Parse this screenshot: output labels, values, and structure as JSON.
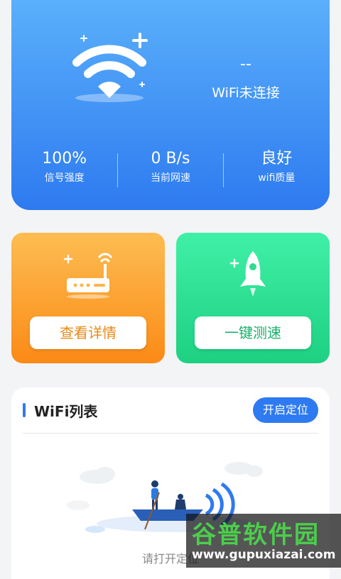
{
  "hero": {
    "ssid_placeholder": "--",
    "status_text": "WiFi未连接",
    "stats": [
      {
        "value": "100%",
        "label": "信号强度"
      },
      {
        "value": "0 B/s",
        "label": "当前网速"
      },
      {
        "value": "良好",
        "label": "wifi质量"
      }
    ]
  },
  "cards": {
    "details_button": "查看详情",
    "speedtest_button": "一键测速"
  },
  "wifi_list": {
    "title": "WiFi列表",
    "enable_location_button": "开启定位",
    "empty_hint": "请打开定位"
  },
  "watermark": {
    "brand": "谷普软件园",
    "url": "www.gupuxiazai.com"
  },
  "colors": {
    "hero_blue": "#2e7af0",
    "card_orange": "#fb8a16",
    "card_green": "#1ed082"
  },
  "icons": [
    "wifi-icon",
    "router-icon",
    "rocket-icon",
    "boat-illustration"
  ]
}
